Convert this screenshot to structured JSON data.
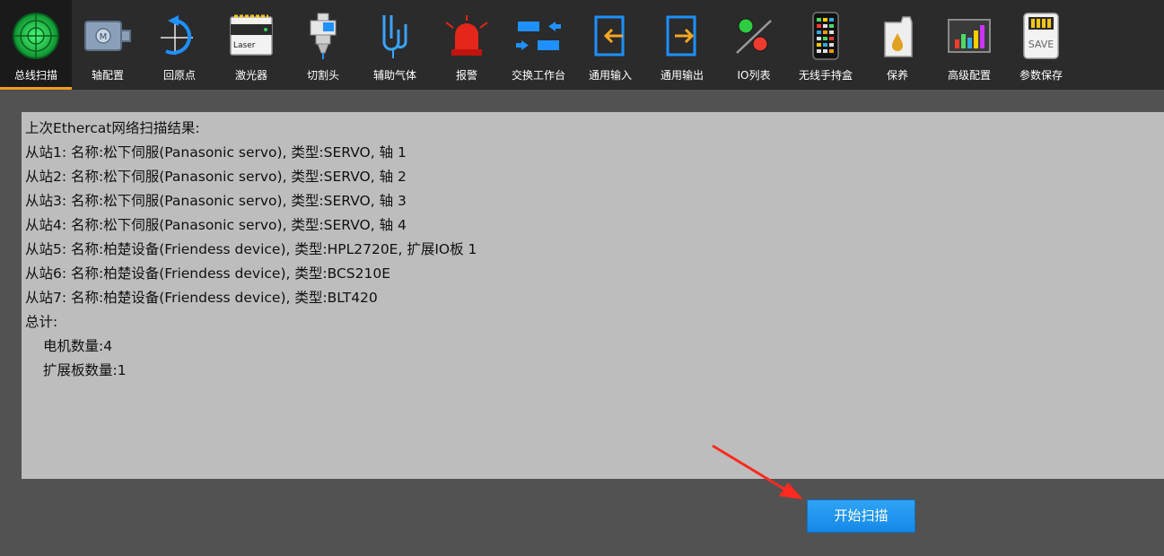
{
  "toolbar": {
    "items": [
      {
        "label": "总线扫描",
        "icon": "radar-icon",
        "active": true
      },
      {
        "label": "轴配置",
        "icon": "motor-icon"
      },
      {
        "label": "回原点",
        "icon": "return-origin-icon"
      },
      {
        "label": "激光器",
        "icon": "laser-icon",
        "text": "Laser"
      },
      {
        "label": "切割头",
        "icon": "cutting-head-icon"
      },
      {
        "label": "辅助气体",
        "icon": "gas-icon"
      },
      {
        "label": "报警",
        "icon": "alarm-light-icon"
      },
      {
        "label": "交换工作台",
        "icon": "exchange-table-icon"
      },
      {
        "label": "通用输入",
        "icon": "input-icon"
      },
      {
        "label": "通用输出",
        "icon": "output-icon"
      },
      {
        "label": "IO列表",
        "icon": "io-list-icon"
      },
      {
        "label": "无线手持盒",
        "icon": "wireless-handheld-icon"
      },
      {
        "label": "保养",
        "icon": "oil-can-icon"
      },
      {
        "label": "高级配置",
        "icon": "bar-chart-icon"
      },
      {
        "label": "参数保存",
        "icon": "save-card-icon",
        "text": "SAVE"
      }
    ]
  },
  "scan_result": {
    "lines": [
      "上次Ethercat网络扫描结果:",
      "从站1: 名称:松下伺服(Panasonic servo), 类型:SERVO, 轴 1",
      "从站2: 名称:松下伺服(Panasonic servo), 类型:SERVO, 轴 2",
      "从站3: 名称:松下伺服(Panasonic servo), 类型:SERVO, 轴 3",
      "从站4: 名称:松下伺服(Panasonic servo), 类型:SERVO, 轴 4",
      "从站5: 名称:柏楚设备(Friendess device), 类型:HPL2720E, 扩展IO板 1",
      "从站6: 名称:柏楚设备(Friendess device), 类型:BCS210E",
      "从站7: 名称:柏楚设备(Friendess device), 类型:BLT420",
      "总计:"
    ],
    "summary": [
      "电机数量:4",
      "扩展板数量:1"
    ]
  },
  "actions": {
    "start_scan_label": "开始扫描"
  },
  "colors": {
    "toolbar_bg": "#2b2b2b",
    "active_underline": "#f39a1e",
    "panel_bg": "#bdbdbd",
    "button_blue": "#1e96ee",
    "arrow_red": "#ff2a1f"
  }
}
